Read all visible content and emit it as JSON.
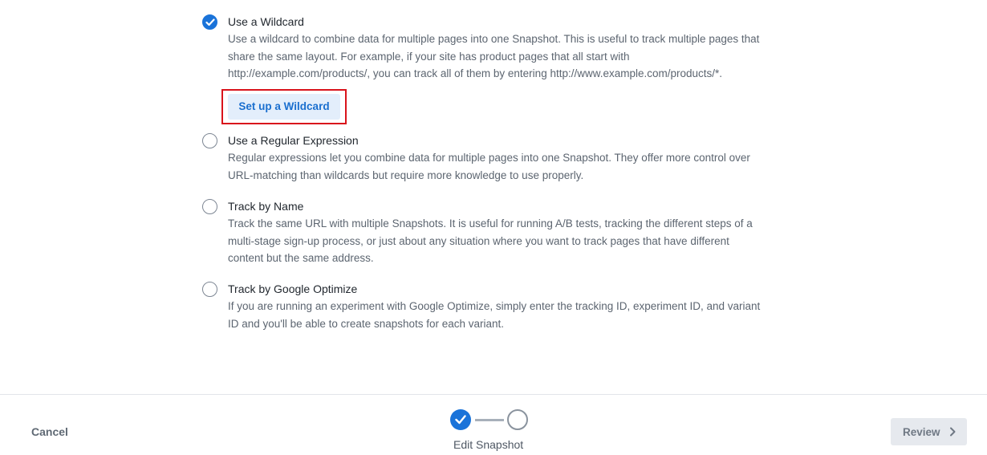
{
  "options": [
    {
      "title": "Use a Wildcard",
      "checked": true,
      "lines": [
        "Use a wildcard to combine data for multiple pages into one Snapshot. This is useful to track multiple pages that",
        "share the same layout. For example, if your site has product pages that all start with",
        "http://example.com/products/, you can track all of them by entering http://www.example.com/products/*."
      ],
      "button_label": "Set up a Wildcard"
    },
    {
      "title": "Use a Regular Expression",
      "checked": false,
      "lines": [
        "Regular expressions let you combine data for multiple pages into one Snapshot. They offer more control over",
        "URL-matching than wildcards but require more knowledge to use properly."
      ]
    },
    {
      "title": "Track by Name",
      "checked": false,
      "lines": [
        "Track the same URL with multiple Snapshots. It is useful for running A/B tests, tracking the different steps of a",
        "multi-stage sign-up process, or just about any situation where you want to track pages that have different",
        "content but the same address."
      ]
    },
    {
      "title": "Track by Google Optimize",
      "checked": false,
      "lines": [
        "If you are running an experiment with Google Optimize, simply enter the tracking ID, experiment ID, and variant",
        "ID and you'll be able to create snapshots for each variant."
      ]
    }
  ],
  "footer": {
    "cancel_label": "Cancel",
    "step_label": "Edit Snapshot",
    "review_label": "Review"
  },
  "icons": {
    "check": "check-icon",
    "chevron": "chevron-right-icon"
  },
  "colors": {
    "accent": "#1a73d9",
    "highlight_border": "#d9131b",
    "button_bg": "#e3eefb"
  }
}
